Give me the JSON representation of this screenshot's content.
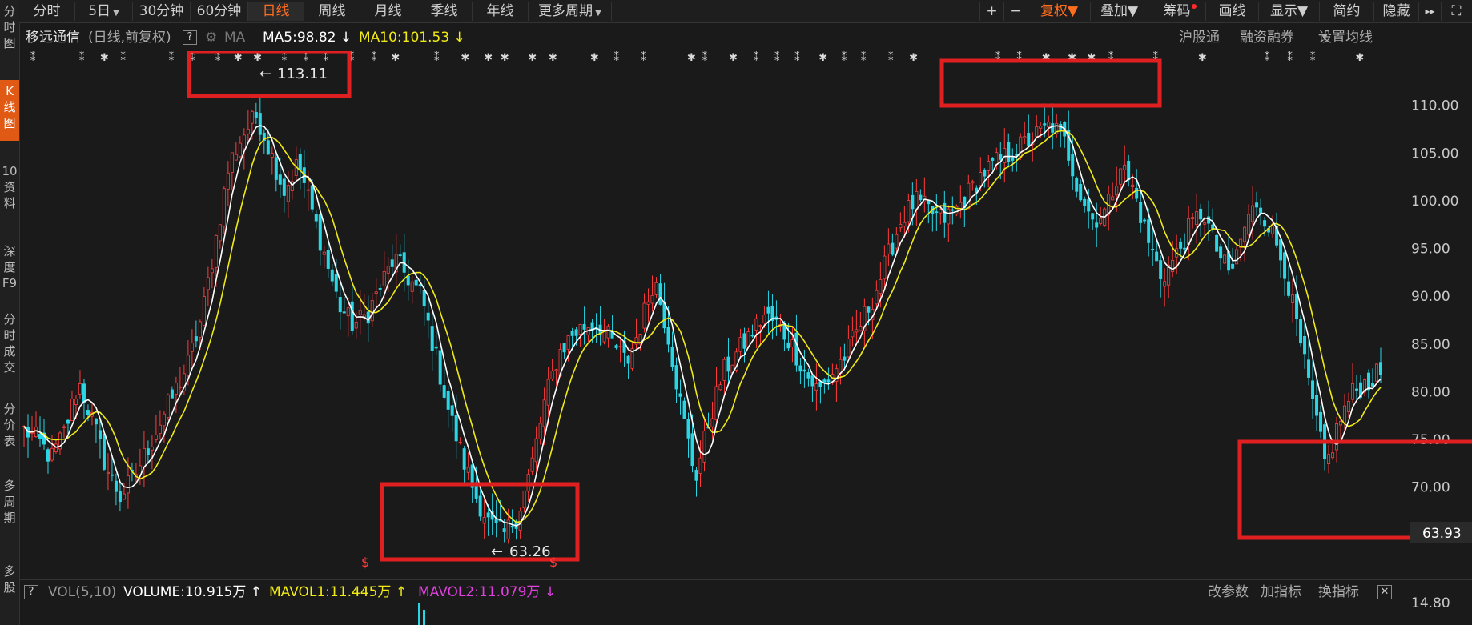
{
  "sidebar": [
    {
      "label": "分时图"
    },
    {
      "label": "K线图"
    },
    {
      "label": "10资料"
    },
    {
      "label": "深度F9"
    },
    {
      "label": "分时成交"
    },
    {
      "label": "分价表"
    },
    {
      "label": "多周期"
    },
    {
      "label": "多股"
    }
  ],
  "tabs": [
    {
      "label": "分时"
    },
    {
      "label": "5日"
    },
    {
      "label": "30分钟"
    },
    {
      "label": "60分钟"
    },
    {
      "label": "日线"
    },
    {
      "label": "周线"
    },
    {
      "label": "月线"
    },
    {
      "label": "季线"
    },
    {
      "label": "年线"
    },
    {
      "label": "更多周期"
    }
  ],
  "toolbar": {
    "zoom_in": "+",
    "zoom_out": "−",
    "fuquan": "复权",
    "overlay": "叠加",
    "chips": "筹码",
    "draw": "画线",
    "display": "显示",
    "simple": "简约",
    "hide": "隐藏",
    "more": "▸▸",
    "fullscreen": "⛶"
  },
  "info": {
    "stock_name": "移远通信",
    "mode": "(日线,前复权)",
    "help": "?",
    "ma_label": "MA",
    "ma5": "MA5:98.82 ↓",
    "ma10": "MA10:101.53 ↓",
    "hgt": "沪股通",
    "rzrq": "融资融券",
    "set_ma": "设置均线"
  },
  "annotations": {
    "high": "113.11",
    "low": "63.26",
    "current_price": "63.93"
  },
  "price_axis": [
    "110.00",
    "105.00",
    "100.00",
    "95.00",
    "90.00",
    "85.00",
    "80.00",
    "75.00",
    "70.00"
  ],
  "volume": {
    "help": "?",
    "title": "VOL(5,10)",
    "volume": "VOLUME:10.915万 ↑",
    "mavol1": "MAVOL1:11.445万 ↑",
    "mavol2": "MAVOL2:11.079万 ↓",
    "change_param": "改参数",
    "add_indicator": "加指标",
    "switch_indicator": "换指标",
    "close": "✕",
    "axis_value": "14.80"
  },
  "colors": {
    "up": "#ff3b3b",
    "down": "#28d6e6",
    "ma5": "#ffffff",
    "ma10": "#f0ea17",
    "accent": "#e05a16",
    "box": "#e02020"
  },
  "chart_data": {
    "type": "candlestick",
    "ylim": [
      62,
      114
    ],
    "axis_ticks": [
      70,
      75,
      80,
      85,
      90,
      95,
      100,
      105,
      110
    ],
    "high": 113.11,
    "low": 63.26,
    "current": 63.93,
    "ma5_last": 98.82,
    "ma10_last": 101.53,
    "close_path": [
      76,
      75,
      73,
      76,
      81,
      77,
      72,
      69,
      71,
      74,
      77,
      80,
      83,
      88,
      96,
      104,
      107,
      109,
      105,
      101,
      104,
      99,
      94,
      89,
      87,
      88,
      91,
      94,
      92,
      90,
      84,
      78,
      73,
      69,
      66,
      65,
      67,
      72,
      79,
      84,
      86,
      87,
      87,
      85,
      83,
      87,
      92,
      86,
      78,
      71,
      77,
      82,
      84,
      86,
      88,
      87,
      85,
      82,
      80,
      82,
      84,
      87,
      90,
      94,
      98,
      100,
      99,
      98,
      99,
      101,
      103,
      104,
      105,
      106,
      107,
      108,
      106,
      101,
      98,
      99,
      104,
      101,
      96,
      92,
      94,
      97,
      99,
      95,
      92,
      97,
      100,
      97,
      93,
      86,
      79,
      72,
      77,
      80,
      81,
      82
    ]
  }
}
